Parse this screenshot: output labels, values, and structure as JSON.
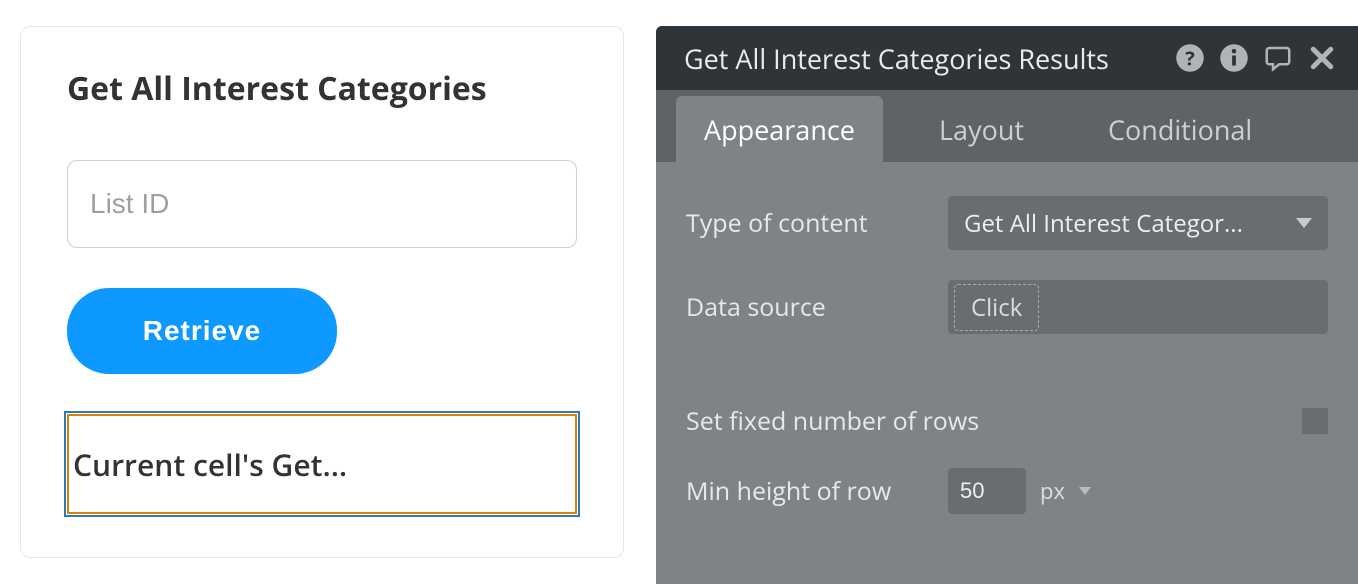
{
  "card": {
    "title": "Get All Interest Categories",
    "list_id_placeholder": "List ID",
    "retrieve_label": "Retrieve",
    "cell_text": "Current cell's Get..."
  },
  "panel": {
    "title": "Get All Interest Categories Results",
    "tabs": {
      "appearance": "Appearance",
      "layout": "Layout",
      "conditional": "Conditional"
    },
    "rows": {
      "type_of_content_label": "Type of content",
      "type_of_content_value": "Get All Interest Categor...",
      "data_source_label": "Data source",
      "data_source_value": "Click",
      "fixed_rows_label": "Set fixed number of rows",
      "min_height_label": "Min height of row",
      "min_height_value": "50",
      "min_height_unit": "px"
    }
  }
}
